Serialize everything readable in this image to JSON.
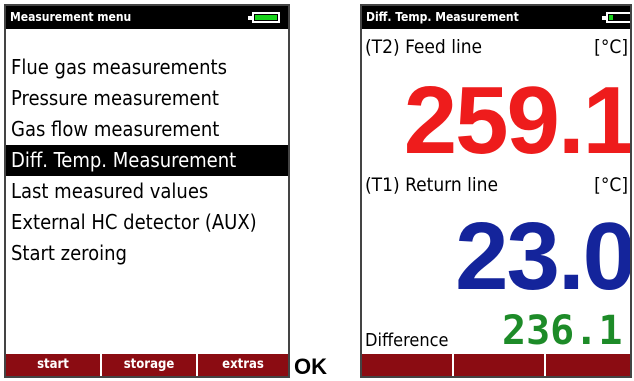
{
  "colors": {
    "titlebar_bg": "#000000",
    "softkey_bg": "#8b0c12",
    "battery_fill": "#19d41c",
    "feed_value": "#ee1c1c",
    "return_value": "#14249b",
    "difference_value": "#1d8b28"
  },
  "menu_screen": {
    "title": "Measurement menu",
    "battery_icon": "battery-icon",
    "items": [
      {
        "label": "Flue gas measurements"
      },
      {
        "label": "Pressure measurement"
      },
      {
        "label": "Gas flow measurement"
      },
      {
        "label": "Diff. Temp. Measurement",
        "selected": true
      },
      {
        "label": "Last measured values"
      },
      {
        "label": "External HC detector (AUX)"
      },
      {
        "label": "Start zeroing"
      }
    ],
    "softkeys": [
      "start",
      "storage",
      "extras"
    ]
  },
  "ok_label": "OK",
  "measurement_screen": {
    "title": "Diff. Temp. Measurement",
    "battery_icon": "battery-icon",
    "feed": {
      "label": "(T2) Feed line",
      "unit": "[°C]",
      "value": "259.1"
    },
    "return": {
      "label": "(T1) Return line",
      "unit": "[°C]",
      "value": "23.0"
    },
    "difference": {
      "label": "Difference",
      "value": "236.1"
    },
    "softkeys": [
      "",
      "",
      ""
    ]
  }
}
